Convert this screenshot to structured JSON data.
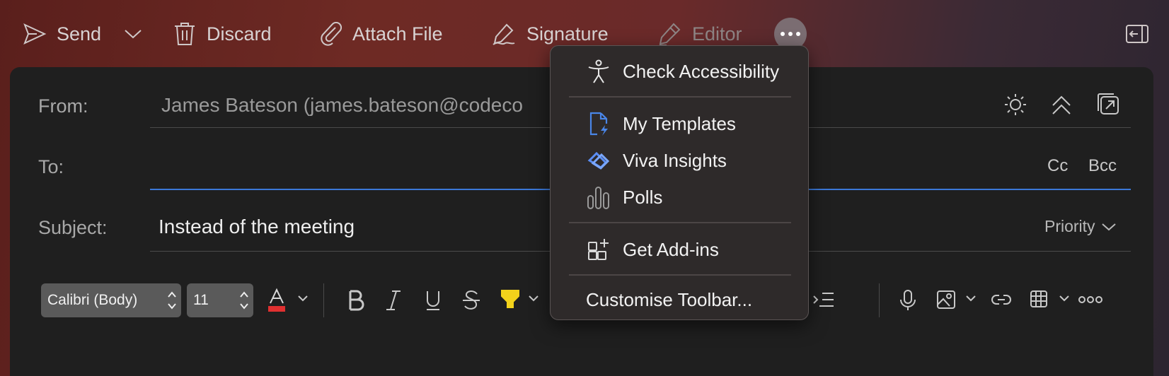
{
  "toolbar": {
    "send_label": "Send",
    "discard_label": "Discard",
    "attach_label": "Attach File",
    "signature_label": "Signature",
    "editor_label": "Editor"
  },
  "fields": {
    "from_label": "From:",
    "from_value": "James Bateson (james.bateson@codeco",
    "to_label": "To:",
    "to_value": "",
    "cc_label": "Cc",
    "bcc_label": "Bcc",
    "subject_label": "Subject:",
    "subject_value": "Instead of the meeting",
    "priority_label": "Priority"
  },
  "format": {
    "font_name": "Calibri (Body)",
    "font_size": "11",
    "text_color": "#e03030",
    "highlight_color": "#f2d21b"
  },
  "menu": {
    "items": [
      {
        "label": "Check Accessibility",
        "icon": "accessibility-icon"
      },
      {
        "label": "My Templates",
        "icon": "templates-icon"
      },
      {
        "label": "Viva Insights",
        "icon": "viva-insights-icon"
      },
      {
        "label": "Polls",
        "icon": "polls-icon"
      },
      {
        "label": "Get Add-ins",
        "icon": "add-ins-icon"
      },
      {
        "label": "Customise Toolbar..."
      }
    ]
  },
  "colors": {
    "accent": "#3b78d8",
    "compose_bg": "#1f1f1f",
    "menu_bg": "#2e2a2a"
  }
}
